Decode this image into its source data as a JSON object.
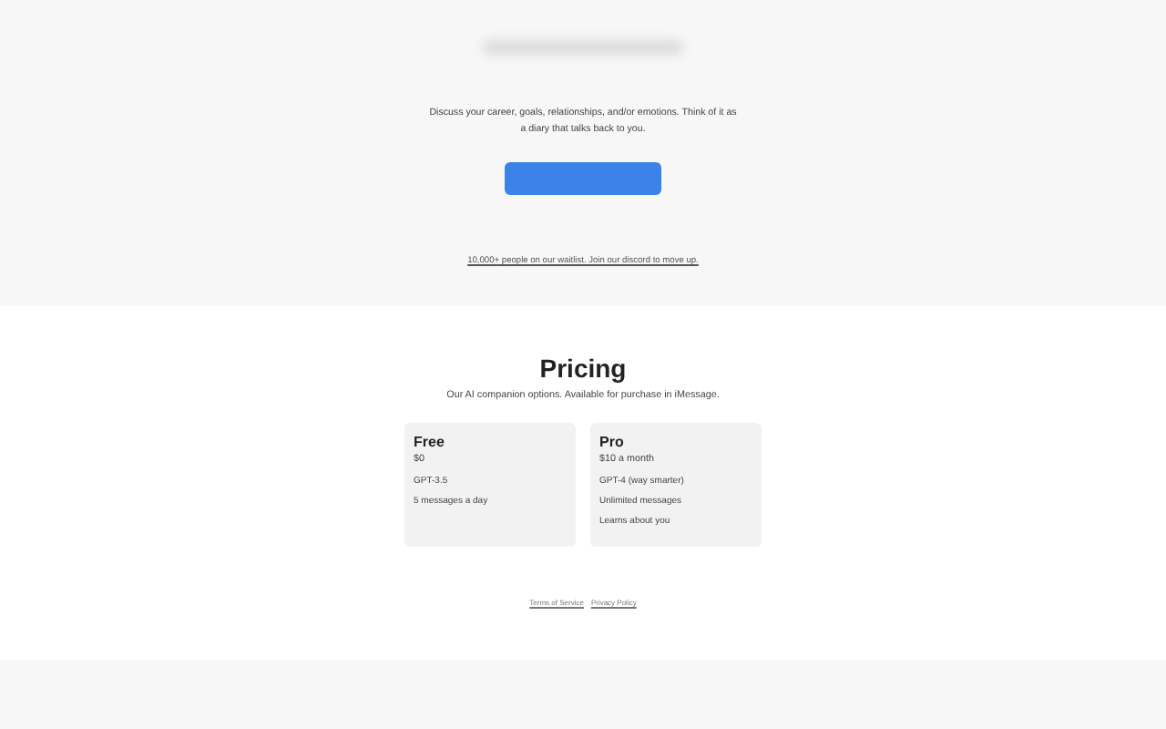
{
  "hero": {
    "description": "Discuss your career, goals, relationships, and/or emotions. Think of it as a diary that talks back to you.",
    "waitlist_link": "10,000+ people on our waitlist. Join our discord to move up."
  },
  "pricing": {
    "title": "Pricing",
    "subtitle": "Our AI companion options. Available for purchase in iMessage.",
    "plans": [
      {
        "name": "Free",
        "price": "$0",
        "features": [
          "GPT-3.5",
          "5 messages a day"
        ]
      },
      {
        "name": "Pro",
        "price": "$10 a month",
        "features": [
          "GPT-4 (way smarter)",
          "Unlimited messages",
          "Learns about you"
        ]
      }
    ]
  },
  "footer_links": [
    "Terms of Service",
    "Privacy Policy"
  ]
}
